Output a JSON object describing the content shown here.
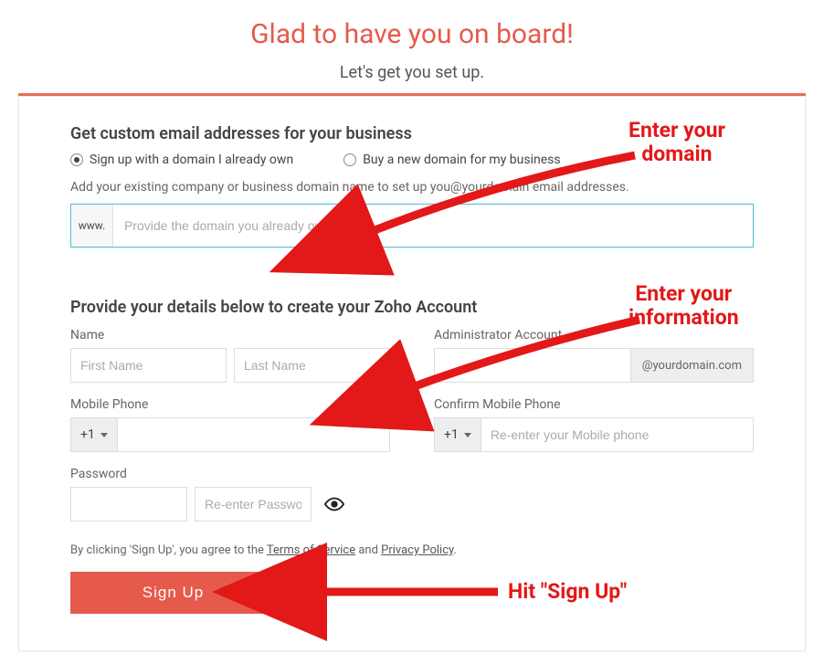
{
  "header": {
    "title": "Glad to have you on board!",
    "subtitle": "Let's get you set up."
  },
  "domain_section": {
    "heading": "Get custom email addresses for your business",
    "option_own": "Sign up with a domain I already own",
    "option_buy": "Buy a new domain for my business",
    "help": "Add your existing company or business domain name to set up you@yourdomain email addresses.",
    "prefix": "www.",
    "placeholder": "Provide the domain you already own"
  },
  "details_section": {
    "heading": "Provide your details below to create your Zoho Account",
    "name_label": "Name",
    "first_name_placeholder": "First Name",
    "last_name_placeholder": "Last Name",
    "admin_label": "Administrator Account",
    "admin_suffix": "@yourdomain.com",
    "mobile_label": "Mobile Phone",
    "confirm_mobile_label": "Confirm Mobile Phone",
    "confirm_mobile_placeholder": "Re-enter your Mobile phone",
    "phone_code": "+1",
    "password_label": "Password",
    "reenter_password_placeholder": "Re-enter Password"
  },
  "terms": {
    "prefix": "By clicking 'Sign Up', you agree to the ",
    "tos": "Terms of Service",
    "mid": " and ",
    "pp": "Privacy Policy",
    "suffix": "."
  },
  "signup_label": "Sign Up",
  "annotations": {
    "domain": "Enter your\ndomain",
    "info": "Enter your\ninformation",
    "signup": "Hit \"Sign Up\""
  },
  "colors": {
    "accent": "#e65a4c",
    "annotation": "#e31818"
  }
}
